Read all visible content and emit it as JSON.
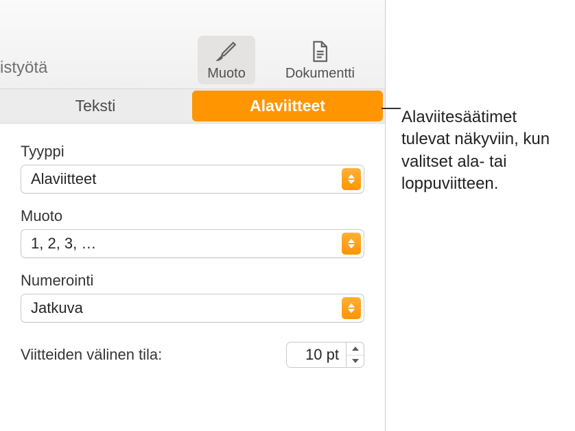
{
  "toolbar": {
    "partial_text": "istyötä",
    "format_label": "Muoto",
    "document_label": "Dokumentti"
  },
  "tabs": {
    "text_label": "Teksti",
    "footnotes_label": "Alaviitteet"
  },
  "fields": {
    "type_label": "Tyyppi",
    "type_value": "Alaviitteet",
    "format_label": "Muoto",
    "format_value": "1, 2, 3, …",
    "numbering_label": "Numerointi",
    "numbering_value": "Jatkuva",
    "spacing_label": "Viitteiden välinen tila:",
    "spacing_value": "10 pt"
  },
  "callout": {
    "text": "Alaviitesäätimet tulevat näkyviin, kun valitset ala- tai loppuviitteen."
  }
}
